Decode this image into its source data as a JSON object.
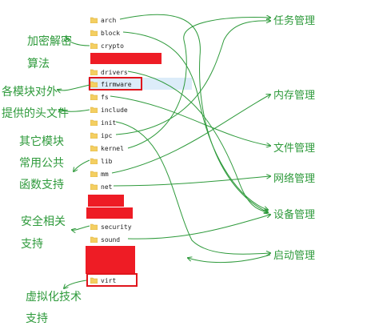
{
  "folders": [
    {
      "name": "arch"
    },
    {
      "name": "block"
    },
    {
      "name": "crypto"
    },
    {
      "name": "drivers"
    },
    {
      "name": "firmware"
    },
    {
      "name": "fs"
    },
    {
      "name": "include"
    },
    {
      "name": "init"
    },
    {
      "name": "ipc"
    },
    {
      "name": "kernel"
    },
    {
      "name": "lib"
    },
    {
      "name": "mm"
    },
    {
      "name": "net"
    },
    {
      "name": "security"
    },
    {
      "name": "sound"
    },
    {
      "name": "virt"
    }
  ],
  "left_labels": [
    {
      "id": "crypto-support",
      "text": "加密解密"
    },
    {
      "id": "crypto-algo",
      "text": "算法"
    },
    {
      "id": "headers-1",
      "text": "各模块对外"
    },
    {
      "id": "headers-2",
      "text": "提供的头文件"
    },
    {
      "id": "lib-1",
      "text": "其它模块"
    },
    {
      "id": "lib-2",
      "text": "常用公共"
    },
    {
      "id": "lib-3",
      "text": "函数支持"
    },
    {
      "id": "security-1",
      "text": "安全相关"
    },
    {
      "id": "security-2",
      "text": "支持"
    },
    {
      "id": "virt-1",
      "text": "虚拟化技术"
    },
    {
      "id": "virt-2",
      "text": "支持"
    }
  ],
  "right_labels": [
    {
      "id": "task-mgmt",
      "text": "任务管理"
    },
    {
      "id": "memory-mgmt",
      "text": "内存管理"
    },
    {
      "id": "file-mgmt",
      "text": "文件管理"
    },
    {
      "id": "network-mgmt",
      "text": "网络管理"
    },
    {
      "id": "device-mgmt",
      "text": "设备管理"
    },
    {
      "id": "boot-mgmt",
      "text": "启动管理"
    }
  ],
  "colors": {
    "annotation_green": "#2e9a3b",
    "redaction_red": "#ee1c25",
    "folder_yellow": "#f4cf62",
    "highlight_blue": "#dcecf9"
  }
}
